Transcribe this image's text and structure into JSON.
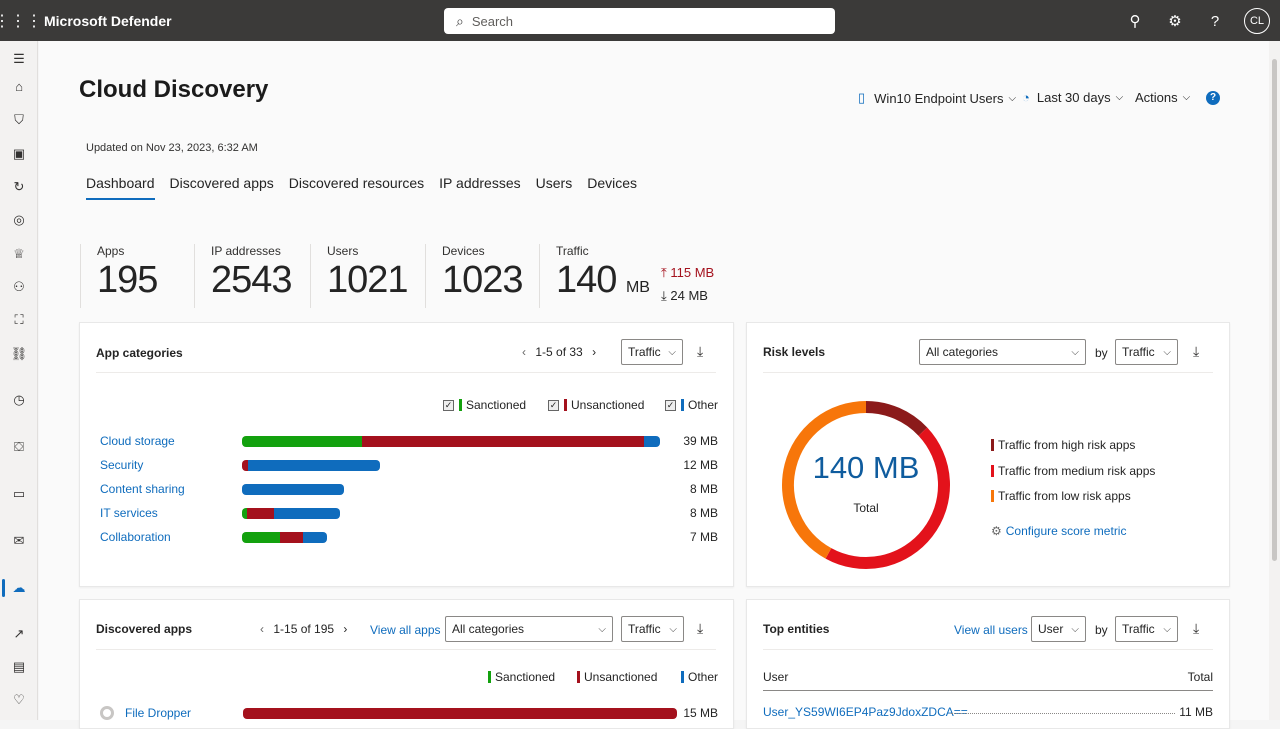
{
  "topbar": {
    "app_title": "Microsoft Defender",
    "search_placeholder": "Search",
    "avatar": "CL"
  },
  "page": {
    "title": "Cloud Discovery",
    "report": "Win10 Endpoint Users",
    "period": "Last 30 days",
    "actions": "Actions",
    "updated": "Updated on Nov 23, 2023, 6:32 AM",
    "tabs": [
      "Dashboard",
      "Discovered apps",
      "Discovered resources",
      "IP addresses",
      "Users",
      "Devices"
    ]
  },
  "stats": {
    "apps": {
      "label": "Apps",
      "value": "195"
    },
    "ips": {
      "label": "IP addresses",
      "value": "2543"
    },
    "users": {
      "label": "Users",
      "value": "1021"
    },
    "devices": {
      "label": "Devices",
      "value": "1023"
    },
    "traffic": {
      "label": "Traffic",
      "value": "140",
      "unit": "MB",
      "up": "115 MB",
      "down": "24 MB"
    }
  },
  "app_categories": {
    "title": "App categories",
    "paging": "1-5 of 33",
    "sort": "Traffic",
    "legend": {
      "sanctioned": "Sanctioned",
      "unsanctioned": "Unsanctioned",
      "other": "Other"
    },
    "rows": [
      {
        "name": "Cloud storage",
        "total": "39 MB",
        "sanctioned": 0.29,
        "unsanctioned": 0.68,
        "other": 0.04,
        "width": 0.94
      },
      {
        "name": "Security",
        "total": "12 MB",
        "sanctioned": 0.0,
        "unsanctioned": 0.04,
        "other": 0.96,
        "width": 0.31
      },
      {
        "name": "Content sharing",
        "total": "8 MB",
        "sanctioned": 0.0,
        "unsanctioned": 0.0,
        "other": 1.0,
        "width": 0.23
      },
      {
        "name": "IT services",
        "total": "8 MB",
        "sanctioned": 0.05,
        "unsanctioned": 0.28,
        "other": 0.67,
        "width": 0.22
      },
      {
        "name": "Collaboration",
        "total": "7 MB",
        "sanctioned": 0.45,
        "unsanctioned": 0.27,
        "other": 0.28,
        "width": 0.19
      }
    ]
  },
  "risk_levels": {
    "title": "Risk levels",
    "category": "All categories",
    "by": "by",
    "sort": "Traffic",
    "total_value": "140 MB",
    "total_label": "Total",
    "legend": {
      "high": "Traffic from high risk apps",
      "medium": "Traffic from medium risk apps",
      "low": "Traffic from low risk apps"
    },
    "configure": "Configure score metric",
    "donut": {
      "high": 0.13,
      "medium": 0.45,
      "low": 0.42
    },
    "colors": {
      "high": "#8b1a1a",
      "medium": "#e3121b",
      "low": "#f7760a"
    }
  },
  "discovered_apps": {
    "title": "Discovered apps",
    "paging": "1-15 of 195",
    "view_all": "View all apps",
    "category": "All categories",
    "sort": "Traffic",
    "legend": {
      "sanctioned": "Sanctioned",
      "unsanctioned": "Unsanctioned",
      "other": "Other"
    },
    "first_row": {
      "name": "File Dropper",
      "total": "15 MB",
      "unsanctioned": 1.0
    }
  },
  "top_entities": {
    "title": "Top entities",
    "view_all": "View all users",
    "entity": "User",
    "by": "by",
    "sort": "Traffic",
    "col_user": "User",
    "col_total": "Total",
    "first_row": {
      "user": "User_YS59WI6EP4Paz9JdoxZDCA==",
      "total": "11 MB"
    }
  },
  "colors": {
    "sanctioned": "#13a10e",
    "unsanctioned": "#a4111d",
    "other": "#0f6cbd",
    "accent": "#0f6cbd"
  }
}
